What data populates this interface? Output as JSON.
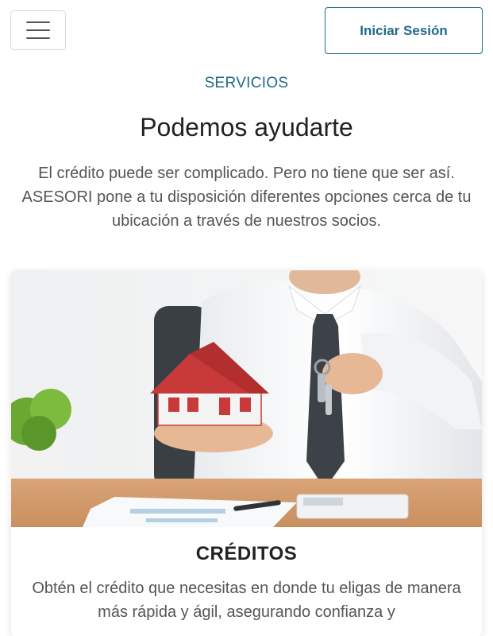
{
  "header": {
    "menu_icon": "hamburger-menu-icon",
    "login_label": "Iniciar Sesión"
  },
  "section": {
    "eyebrow": "SERVICIOS",
    "title": "Podemos ayudarte",
    "intro": "El crédito puede ser complicado. Pero no tiene que ser así. ASESORI pone a tu disposición diferentes opciones cerca de tu ubicación a través de nuestros socios."
  },
  "card": {
    "title": "CRÉDITOS",
    "text": "Obtén el crédito que necesitas en donde tu eligas de manera más rápida y ágil, asegurando confianza y"
  },
  "colors": {
    "accent": "#1e6a8a",
    "text": "#555555",
    "heading": "#222222"
  }
}
